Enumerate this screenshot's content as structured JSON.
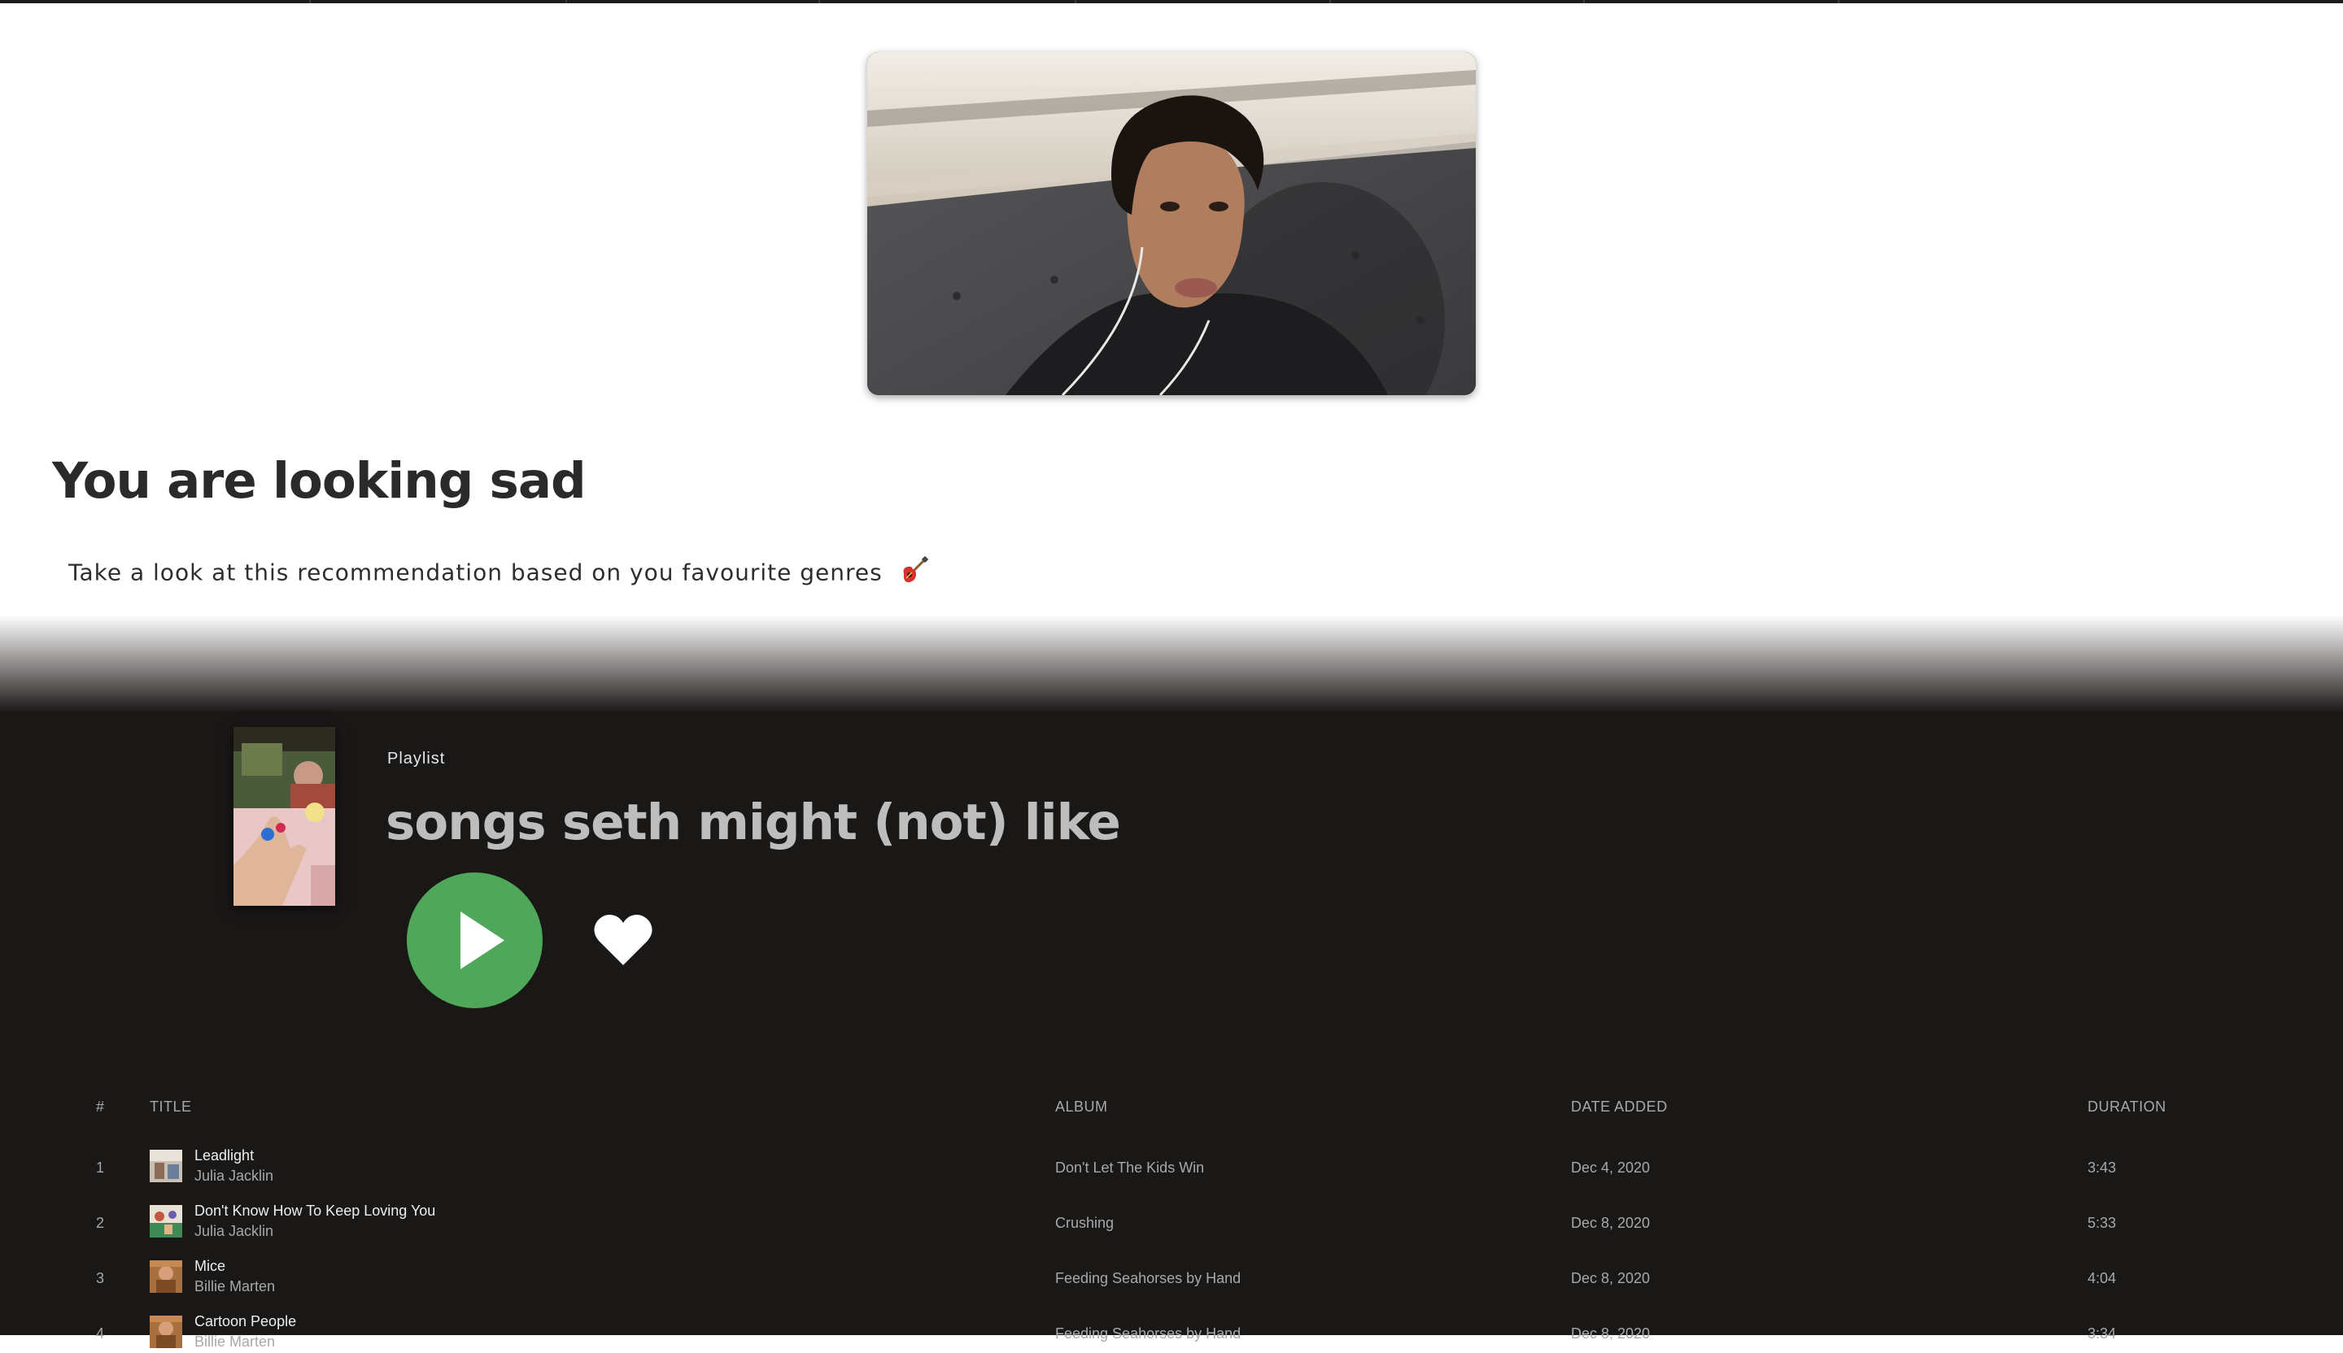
{
  "emotion": {
    "heading": "You are looking sad",
    "subtext": "Take a look at this recommendation based on you favourite genres",
    "emoji_icon": "guitar-icon"
  },
  "playlist": {
    "type_label": "Playlist",
    "title": "songs seth might (not) like",
    "accent_color": "#4fa85a",
    "play_icon": "play-icon",
    "like_icon": "heart-icon"
  },
  "table": {
    "headers": {
      "num": "#",
      "title": "TITLE",
      "album": "ALBUM",
      "date": "DATE ADDED",
      "duration": "DURATION"
    },
    "rows": [
      {
        "num": "1",
        "title": "Leadlight",
        "artist": "Julia Jacklin",
        "album": "Don't Let The Kids Win",
        "date": "Dec 4, 2020",
        "duration": "3:43"
      },
      {
        "num": "2",
        "title": "Don't Know How To Keep Loving You",
        "artist": "Julia Jacklin",
        "album": "Crushing",
        "date": "Dec 8, 2020",
        "duration": "5:33"
      },
      {
        "num": "3",
        "title": "Mice",
        "artist": "Billie Marten",
        "album": "Feeding Seahorses by Hand",
        "date": "Dec 8, 2020",
        "duration": "4:04"
      },
      {
        "num": "4",
        "title": "Cartoon People",
        "artist": "Billie Marten",
        "album": "Feeding Seahorses by Hand",
        "date": "Dec 8, 2020",
        "duration": "3:34"
      }
    ]
  }
}
